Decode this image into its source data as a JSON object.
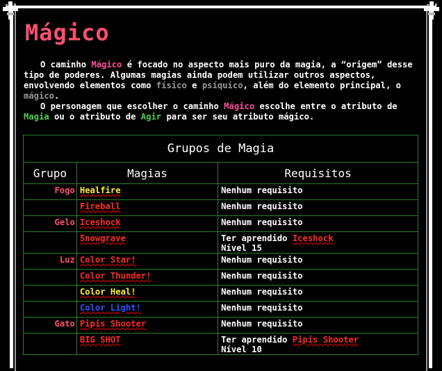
{
  "title": "Mágico",
  "para1": {
    "t1": "O caminho ",
    "w1": "Mágico",
    "t2": " é focado no aspecto mais puro da magia, a “origem” desse tipo de poderes. Algumas magias ainda podem utilizar outros aspectos, envolvendo elementos como ",
    "w2": "físico",
    "t3": " e ",
    "w3": "psíquico",
    "t4": ", além do elemento principal, o ",
    "w4": "mágico",
    "t5": "."
  },
  "para2": {
    "t1": "O personagem que escolher o caminho ",
    "w1": "Mágico",
    "t2": " escolhe entre o atributo de ",
    "w2": "Magia",
    "t3": " ou o atributo de ",
    "w3": "Agir",
    "t4": " para ser seu atributo mágico."
  },
  "table": {
    "caption": "Grupos de Magia",
    "headers": [
      "Grupo",
      "Magias",
      "Requisitos"
    ],
    "rows": [
      {
        "group": "Fogo",
        "spell": "Healfire",
        "spell_color": "#ffef3a",
        "req": "Nenhum requisito",
        "req_spell": "",
        "level": ""
      },
      {
        "group": "",
        "spell": "Fireball",
        "spell_color": "#ff2a2a",
        "req": "Nenhum requisito",
        "req_spell": "",
        "level": ""
      },
      {
        "group": "Gelo",
        "spell": "Iceshock",
        "spell_color": "#ff2a2a",
        "req": "Nenhum requisito",
        "req_spell": "",
        "level": ""
      },
      {
        "group": "",
        "spell": "Snowgrave",
        "spell_color": "#ff2a2a",
        "req": "Ter aprendido ",
        "req_spell": "Iceshock",
        "level": "Nível 15"
      },
      {
        "group": "Luz",
        "spell": "Color Star!",
        "spell_color": "#ff2a2a",
        "req": "Nenhum requisito",
        "req_spell": "",
        "level": ""
      },
      {
        "group": "",
        "spell": "Color Thunder!",
        "spell_color": "#ff2a2a",
        "req": "Nenhum requisito",
        "req_spell": "",
        "level": ""
      },
      {
        "group": "",
        "spell": "Color Heal!",
        "spell_color": "#ffef3a",
        "req": "Nenhum requisito",
        "req_spell": "",
        "level": ""
      },
      {
        "group": "",
        "spell": "Color Light!",
        "spell_color": "#2a55ff",
        "req": "Nenhum requisito",
        "req_spell": "",
        "level": ""
      },
      {
        "group": "Gato",
        "spell": "Pipis Shooter",
        "spell_color": "#ff2a2a",
        "req": "Nenhum requisito",
        "req_spell": "",
        "level": ""
      },
      {
        "group": "",
        "spell": "BIG SHOT",
        "spell_color": "#ff2a2a",
        "req": "Ter aprendido ",
        "req_spell": "Pipis Shooter",
        "level": "Nível 10"
      }
    ]
  },
  "colors": {
    "title": "#ff4f6f",
    "magic": "#ff4fa0",
    "green": "#4fd04f",
    "border": "#2e7d2e"
  }
}
